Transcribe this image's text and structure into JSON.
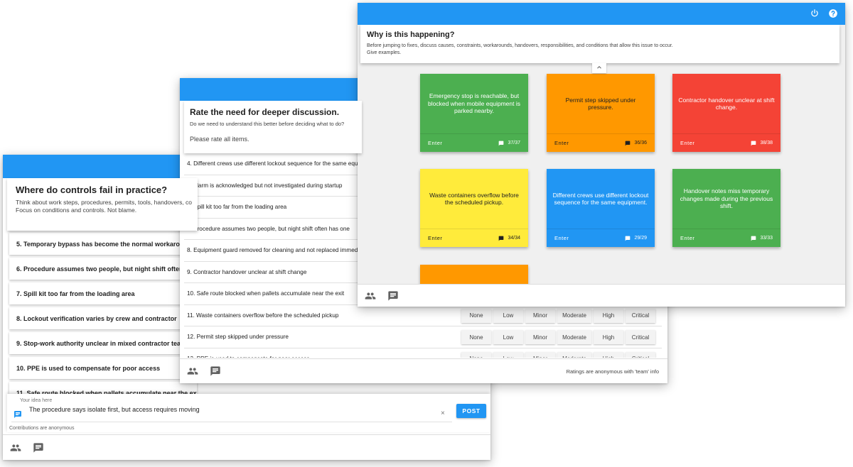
{
  "screen1": {
    "panel_title": "Where do controls fail in practice?",
    "panel_line1": "Think about work steps, procedures, permits, tools, handovers, co",
    "panel_line2": "Focus on conditions and controls. Not blame.",
    "cards": [
      "",
      "5. Temporary bypass has become the normal workaround",
      "6. Procedure assumes two people, but night shift often has",
      "7. Spill kit too far from the loading area",
      "8. Lockout verification varies by crew and contractor",
      "9. Stop-work authority unclear in mixed contractor teams",
      "10. PPE is used to compensate for poor access",
      "11. Safe route blocked when pallets accumulate near the exit"
    ],
    "compose": {
      "label": "Your idea here",
      "value": "The procedure says isolate first, but access requires moving",
      "clear": "×",
      "post": "POST",
      "note": "Contributions are anonymous"
    }
  },
  "screen2": {
    "panel_title": "Rate the need for deeper discussion.",
    "panel_text": "Do we need to understand this better before deciding what to do?",
    "rate_note": "Please rate all items.",
    "rating_options": [
      "None",
      "Low",
      "Minor",
      "Moderate",
      "High",
      "Critical"
    ],
    "rows": [
      {
        "label": "4. Different crews use different lockout sequence for the same equipment",
        "buttons": false
      },
      {
        "label": "5. Alarm is acknowledged but not investigated during startup",
        "buttons": false
      },
      {
        "label": "6. Spill kit too far from the loading area",
        "buttons": false
      },
      {
        "label": "7. Procedure assumes two people, but night shift often has one",
        "buttons": false
      },
      {
        "label": "8. Equipment guard removed for cleaning and not replaced immediately",
        "buttons": false
      },
      {
        "label": "9. Contractor handover unclear at shift change",
        "buttons": false
      },
      {
        "label": "10. Safe route blocked when pallets accumulate near the exit",
        "buttons": false
      },
      {
        "label": "11. Waste containers overflow before the scheduled pickup",
        "buttons": true
      },
      {
        "label": "12. Permit step skipped under pressure",
        "buttons": true
      },
      {
        "label": "13. PPE is used to compensate for poor access",
        "buttons": true
      }
    ],
    "footer_note": "Ratings are anonymous with 'team' info"
  },
  "screen3": {
    "panel_title": "Why is this happening?",
    "panel_line1": "Before jumping to fixes, discuss causes, constraints, workarounds, handovers, responsibilities, and conditions that allow this issue to occur.",
    "panel_line2": "Give examples.",
    "cards": [
      {
        "text": "Emergency stop is reachable, but blocked when mobile equipment is parked nearby.",
        "enter": "Enter",
        "count": "37/37",
        "color": "#4caf50",
        "dark": false
      },
      {
        "text": "Permit step skipped under pressure.",
        "enter": "Enter",
        "count": "36/36",
        "color": "#ff9800",
        "dark": true
      },
      {
        "text": "Contractor handover unclear at shift change.",
        "enter": "Enter",
        "count": "38/38",
        "color": "#f44336",
        "dark": false
      },
      {
        "text": "Waste containers overflow before the scheduled pickup.",
        "enter": "Enter",
        "count": "34/34",
        "color": "#ffeb3b",
        "dark": true
      },
      {
        "text": "Different crews use different lockout sequence for the same equipment.",
        "enter": "Enter",
        "count": "29/29",
        "color": "#2196f3",
        "dark": false
      },
      {
        "text": "Handover notes miss temporary changes made during the previous shift.",
        "enter": "Enter",
        "count": "33/33",
        "color": "#4caf50",
        "dark": false
      },
      {
        "text": "",
        "enter": "",
        "count": "",
        "color": "#ff9800",
        "dark": true
      }
    ]
  },
  "colors": {
    "primary": "#2196f3"
  }
}
